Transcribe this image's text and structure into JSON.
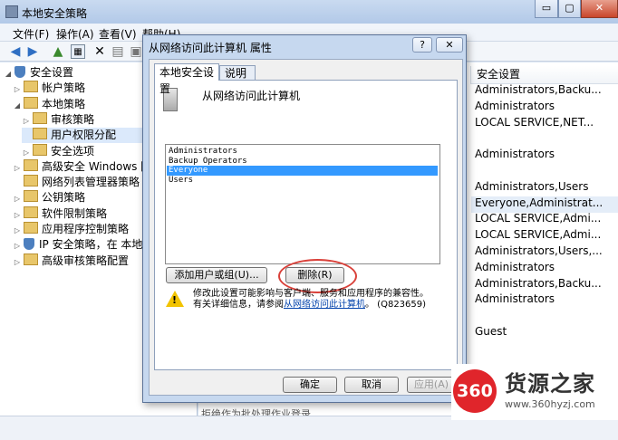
{
  "window": {
    "title": "本地安全策略",
    "minimize": "▭",
    "maximize": "▢",
    "close": "✕"
  },
  "menu": [
    "文件(F)",
    "操作(A)",
    "查看(V)",
    "帮助(H)"
  ],
  "tree": [
    {
      "label": "安全设置",
      "indent": 0,
      "arrow": "◢",
      "icon": "shield-icon"
    },
    {
      "label": "帐户策略",
      "indent": 1,
      "arrow": "▷",
      "icon": "folder-icon"
    },
    {
      "label": "本地策略",
      "indent": 1,
      "arrow": "◢",
      "icon": "folder-icon"
    },
    {
      "label": "审核策略",
      "indent": 2,
      "arrow": "▷",
      "icon": "folder-icon"
    },
    {
      "label": "用户权限分配",
      "indent": 2,
      "arrow": "",
      "icon": "folder-icon",
      "selected": true
    },
    {
      "label": "安全选项",
      "indent": 2,
      "arrow": "▷",
      "icon": "folder-icon"
    },
    {
      "label": "高级安全 Windows 防火",
      "indent": 1,
      "arrow": "▷",
      "icon": "folder-icon"
    },
    {
      "label": "网络列表管理器策略",
      "indent": 1,
      "arrow": "",
      "icon": "folder-icon"
    },
    {
      "label": "公钥策略",
      "indent": 1,
      "arrow": "▷",
      "icon": "folder-icon"
    },
    {
      "label": "软件限制策略",
      "indent": 1,
      "arrow": "▷",
      "icon": "folder-icon"
    },
    {
      "label": "应用程序控制策略",
      "indent": 1,
      "arrow": "▷",
      "icon": "folder-icon"
    },
    {
      "label": "IP 安全策略，在 本地计",
      "indent": 1,
      "arrow": "▷",
      "icon": "shield-icon"
    },
    {
      "label": "高级审核策略配置",
      "indent": 1,
      "arrow": "▷",
      "icon": "folder-icon"
    }
  ],
  "right_pane": {
    "column_header": "安全设置",
    "rows": [
      {
        "text": "Administrators,Backu..."
      },
      {
        "text": "Administrators"
      },
      {
        "text": "LOCAL SERVICE,NET..."
      },
      {
        "text": ""
      },
      {
        "text": "Administrators"
      },
      {
        "text": ""
      },
      {
        "text": "Administrators,Users"
      },
      {
        "text": "Everyone,Administrat...",
        "selected": true
      },
      {
        "text": "LOCAL SERVICE,Admi..."
      },
      {
        "text": "LOCAL SERVICE,Admi..."
      },
      {
        "text": "Administrators,Users,..."
      },
      {
        "text": "Administrators"
      },
      {
        "text": "Administrators,Backu..."
      },
      {
        "text": "Administrators"
      },
      {
        "text": ""
      },
      {
        "text": "Guest"
      }
    ],
    "partial_row": "拒绝作为批处理作业登录"
  },
  "dialog": {
    "title": "从网络访问此计算机 属性",
    "help": "?",
    "close": "✕",
    "tabs": [
      "本地安全设置",
      "说明"
    ],
    "policy_name": "从网络访问此计算机",
    "accounts": [
      "Administrators",
      "Backup Operators",
      "Everyone",
      "Users"
    ],
    "selected_account": "Everyone",
    "add_button": "添加用户或组(U)...",
    "remove_button": "删除(R)",
    "warning_line1": "修改此设置可能影响与客户端、服务和应用程序的兼容性。",
    "warning_line2_prefix": "有关详细信息，请参阅",
    "warning_link": "从网络访问此计算机",
    "warning_suffix": "。 (Q823659)",
    "ok": "确定",
    "cancel": "取消",
    "apply": "应用(A)"
  },
  "watermark": {
    "badge": "360",
    "title": "货源之家",
    "url": "www.360hyzj.com"
  }
}
